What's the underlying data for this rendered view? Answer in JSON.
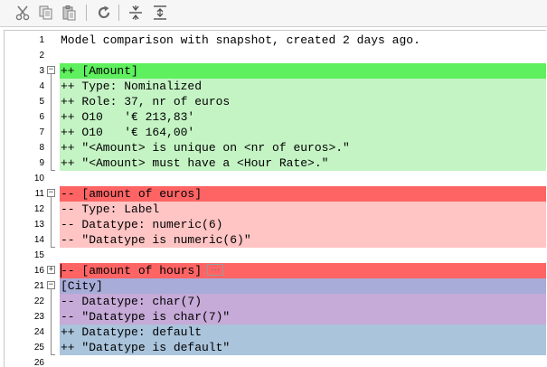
{
  "toolbar": {
    "buttons": [
      {
        "name": "cut-button",
        "icon": "scissors-icon"
      },
      {
        "name": "copy-button",
        "icon": "copy-icon"
      },
      {
        "name": "paste-button",
        "icon": "paste-icon"
      },
      {
        "name": "refresh-button",
        "icon": "refresh-icon"
      },
      {
        "name": "collapse-all-button",
        "icon": "collapse-icon"
      },
      {
        "name": "expand-all-button",
        "icon": "expand-icon"
      }
    ]
  },
  "colors": {
    "added_header": "#5ef05e",
    "added_body": "#c4f4c4",
    "removed_header": "#ff6464",
    "removed_body": "#ffc4c4",
    "changed_header": "#a8acd8",
    "changed_removed": "#c6aad8",
    "changed_added": "#aac4dc"
  },
  "lines": [
    {
      "num": "1",
      "text": "Model comparison with snapshot, created 2 days ago.",
      "kind": "plain"
    },
    {
      "num": "2",
      "text": "",
      "kind": "plain"
    },
    {
      "num": "3",
      "text": "++ [Amount]",
      "kind": "added_header",
      "fold": "minus"
    },
    {
      "num": "4",
      "text": "++ Type: Nominalized",
      "kind": "added_body"
    },
    {
      "num": "5",
      "text": "++ Role: 37, nr of euros",
      "kind": "added_body"
    },
    {
      "num": "6",
      "text": "++ O10   '€ 213,83'",
      "kind": "added_body"
    },
    {
      "num": "7",
      "text": "++ O10   '€ 164,00'",
      "kind": "added_body"
    },
    {
      "num": "8",
      "text": "++ \"<Amount> is unique on <nr of euros>.\"",
      "kind": "added_body"
    },
    {
      "num": "9",
      "text": "++ \"<Amount> must have a <Hour Rate>.\"",
      "kind": "added_body"
    },
    {
      "num": "10",
      "text": "",
      "kind": "plain"
    },
    {
      "num": "11",
      "text": "-- [amount of euros]",
      "kind": "removed_header",
      "fold": "minus"
    },
    {
      "num": "12",
      "text": "-- Type: Label",
      "kind": "removed_body"
    },
    {
      "num": "13",
      "text": "-- Datatype: numeric(6)",
      "kind": "removed_body"
    },
    {
      "num": "14",
      "text": "-- \"Datatype is numeric(6)\"",
      "kind": "removed_body"
    },
    {
      "num": "15",
      "text": "",
      "kind": "plain"
    },
    {
      "num": "16",
      "text": "-- [amount of hours]",
      "kind": "removed_header",
      "fold": "plus",
      "ellipsis": "···"
    },
    {
      "num": "21",
      "text": "[City]",
      "kind": "changed_header",
      "fold": "minus"
    },
    {
      "num": "22",
      "text": "-- Datatype: char(7)",
      "kind": "changed_removed"
    },
    {
      "num": "23",
      "text": "-- \"Datatype is char(7)\"",
      "kind": "changed_removed"
    },
    {
      "num": "24",
      "text": "++ Datatype: default",
      "kind": "changed_added"
    },
    {
      "num": "25",
      "text": "++ \"Datatype is default\"",
      "kind": "changed_added"
    },
    {
      "num": "26",
      "text": "",
      "kind": "plain"
    }
  ]
}
